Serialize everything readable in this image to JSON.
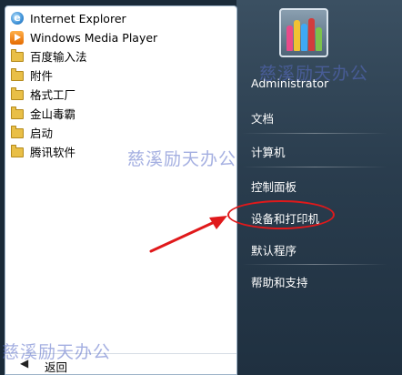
{
  "programs": [
    {
      "label": "Internet Explorer",
      "icon": "internet-explorer-icon"
    },
    {
      "label": "Windows Media Player",
      "icon": "windows-media-player-icon"
    },
    {
      "label": "百度输入法",
      "icon": "folder-icon"
    },
    {
      "label": "附件",
      "icon": "folder-icon"
    },
    {
      "label": "格式工厂",
      "icon": "folder-icon"
    },
    {
      "label": "金山毒霸",
      "icon": "folder-icon"
    },
    {
      "label": "启动",
      "icon": "folder-icon"
    },
    {
      "label": "腾讯软件",
      "icon": "folder-icon"
    }
  ],
  "back": {
    "label": "返回",
    "icon": "back-arrow-icon"
  },
  "right_menu": {
    "user": "Administrator",
    "documents": "文档",
    "computer": "计算机",
    "control_panel": "控制面板",
    "devices_printers": "设备和打印机",
    "default_programs": "默认程序",
    "help_support": "帮助和支持"
  },
  "watermark": "慈溪励天办公",
  "colors": {
    "highlight_annotation": "#e0191b",
    "right_pane": "#2a3d4e",
    "watermark": "#5a6ec8"
  }
}
